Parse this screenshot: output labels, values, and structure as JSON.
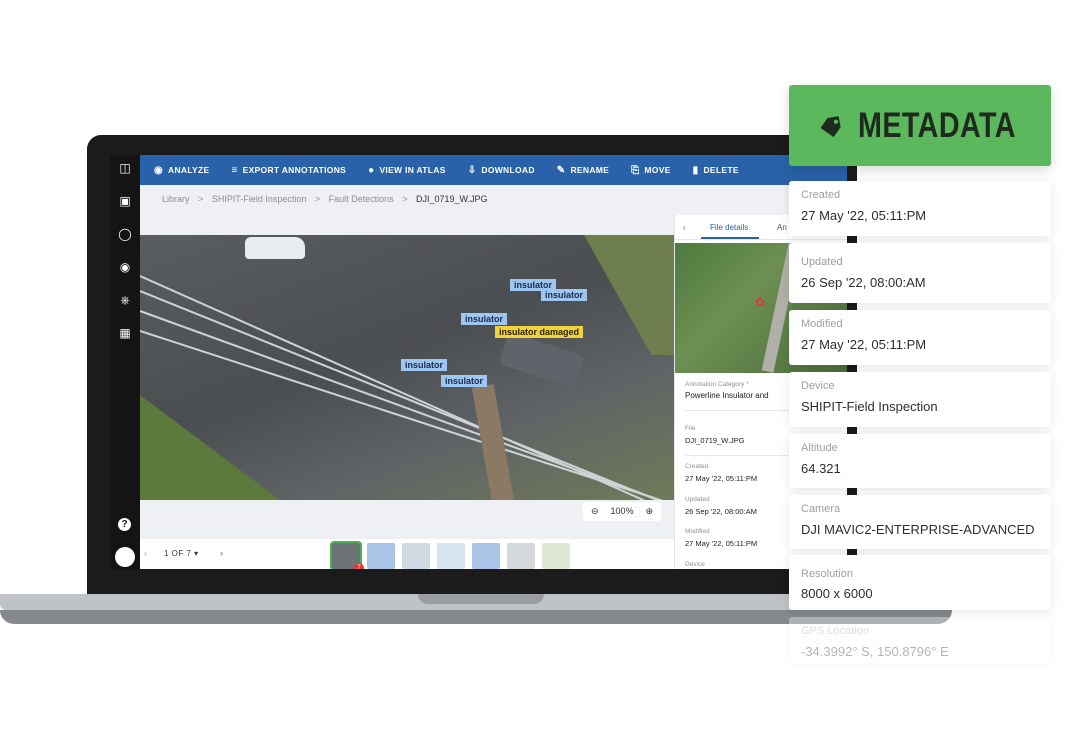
{
  "toolbar": {
    "analyze": "ANALYZE",
    "export": "EXPORT ANNOTATIONS",
    "atlas": "VIEW IN ATLAS",
    "download": "DOWNLOAD",
    "rename": "RENAME",
    "move": "MOVE",
    "delete": "DELETE"
  },
  "breadcrumb": {
    "library": "Library",
    "folder": "SHIPIT-Field Inspection",
    "subfolder": "Fault Detections",
    "current": "DJI_0719_W.JPG",
    "sep": ">"
  },
  "annotations": [
    {
      "label": "insulator",
      "type": "normal"
    },
    {
      "label": "insulator",
      "type": "normal"
    },
    {
      "label": "insulator",
      "type": "normal"
    },
    {
      "label": "insulator damaged",
      "type": "damaged"
    },
    {
      "label": "insulator",
      "type": "normal"
    },
    {
      "label": "insulator",
      "type": "normal"
    }
  ],
  "zoom": {
    "level": "100%"
  },
  "pager": {
    "text": "1 OF 7",
    "badge": "7"
  },
  "pane": {
    "tab_details": "File details",
    "tab_annotations": "An",
    "category_label": "Annotation Category *",
    "category_value": "Powerline Insulator and",
    "file_label": "File",
    "file_value": "DJI_0719_W.JPG",
    "created_label": "Created",
    "created_value": "27 May '22, 05:11:PM",
    "updated_label": "Updated",
    "updated_value": "26 Sep '22, 08:00:AM",
    "modified_label": "Modified",
    "modified_value": "27 May '22, 05:11:PM",
    "device_label": "Device"
  },
  "metadata": {
    "title": "METADATA",
    "accent": "#5cb85c",
    "fields": [
      {
        "key": "Created",
        "value": "27 May '22, 05:11:PM"
      },
      {
        "key": "Updated",
        "value": "26 Sep '22, 08:00:AM"
      },
      {
        "key": "Modified",
        "value": "27 May '22, 05:11:PM"
      },
      {
        "key": "Device",
        "value": "SHIPIT-Field Inspection"
      },
      {
        "key": "Altitude",
        "value": "64.321"
      },
      {
        "key": "Camera",
        "value": "DJI MAVIC2-ENTERPRISE-ADVANCED"
      },
      {
        "key": "Resolution",
        "value": "8000 x 6000"
      },
      {
        "key": "GPS Location",
        "value": "-34.3992° S, 150.8796° E"
      }
    ]
  },
  "colors": {
    "toolbar": "#2962a8",
    "rail": "#141414",
    "annotation": "#9ec6f2",
    "damaged": "#f2d33a"
  }
}
